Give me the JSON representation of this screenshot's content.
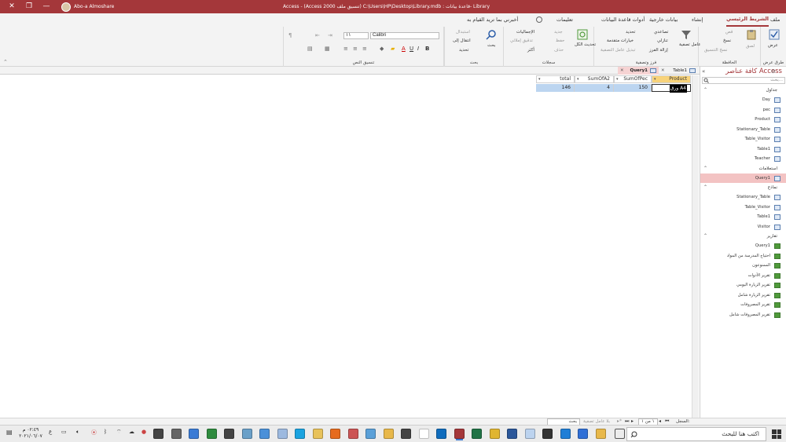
{
  "titlebar": {
    "title": "Access  -  (Access 2000 تنسيق ملف) C:\\Users\\HP\\Desktop\\Library.mdb : قاعدة بيانات- Library",
    "user": "Abo-a Almoshare",
    "minimize": "—",
    "maximize": "❐",
    "close": "✕"
  },
  "menu": {
    "tabs": [
      "ملف",
      "الشريط الرئيسي",
      "إنشاء",
      "بيانات خارجية",
      "أدوات قاعدة البيانات",
      "تعليمات"
    ],
    "tellme": "أخبرني بما تريد القيام به"
  },
  "ribbon": {
    "views": {
      "label": "طرق عرض",
      "view": "عرض"
    },
    "clipboard": {
      "label": "الحافظة",
      "cut": "قص",
      "copy": "نسخ",
      "paste": "لصق",
      "format_painter": "نسخ التنسيق"
    },
    "sort_filter": {
      "label": "فرز وتصفية",
      "filter": "عامل تصفية",
      "ascending": "تصاعدي",
      "descending": "تنازلي",
      "remove_sort": "إزالة الفرز",
      "selection": "تحديد",
      "advanced": "خيارات متقدمة",
      "toggle_filter": "تبديل عامل التصفية"
    },
    "records": {
      "label": "سجلات",
      "refresh_all": "تحديث الكل",
      "new": "جديد",
      "save": "حفظ",
      "delete": "حذف",
      "totals": "الإجماليات",
      "spelling": "تدقيق إملائي",
      "more": "أكثر"
    },
    "find": {
      "label": "بحث",
      "find": "بحث",
      "replace": "استبدال",
      "goto": "انتقال إلى",
      "select": "تحديد"
    },
    "text_formatting": {
      "label": "تنسيق النص",
      "font": "Calibri",
      "size": "١١"
    }
  },
  "nav": {
    "title": "كافة عناصر Access",
    "search_placeholder": "بحث...",
    "sections": [
      {
        "label": "جداول",
        "items": [
          "Day",
          "pec",
          "Product",
          "Stationary_Table",
          "Table_Visitor",
          "Table1",
          "Teacher"
        ]
      },
      {
        "label": "استعلامات",
        "items": [
          "Query1"
        ]
      },
      {
        "label": "نماذج",
        "items": [
          "Stationary_Table",
          "Table_Visitor",
          "Table1",
          "Visitor"
        ]
      },
      {
        "label": "تقارير",
        "items": [
          "Query1",
          "احتياج المدرسة من المواد",
          "الممنوعون",
          "تقرير الأدوات",
          "تقرير الزيارة اليومي",
          "تقرير الزيارة شامل",
          "تقرير المصروفات",
          "تقرير المصروفات شامل"
        ]
      }
    ],
    "selected": "Query1"
  },
  "doctabs": {
    "table1": "Table1",
    "query1": "Query1"
  },
  "datasheet": {
    "columns": [
      "Product",
      "SumOfPec",
      "SumOfA2",
      "total"
    ],
    "rows": [
      [
        "ورق A4",
        "150",
        "4",
        "146"
      ]
    ]
  },
  "statusbar": {
    "record_label": "السجل:",
    "record_pos": "١ من ١",
    "no_filter": "بلا عامل تصفية",
    "search": "بحث"
  },
  "taskbar": {
    "search_placeholder": "اكتب هنا للبحث",
    "time": "٠٢:٤٩ م",
    "date": "٢٠٢١/٠٦/٠٧",
    "lang": "ع"
  },
  "colors": {
    "accent": "#a4373a",
    "selection": "#f8d37a",
    "row": "#bcd5f0"
  }
}
